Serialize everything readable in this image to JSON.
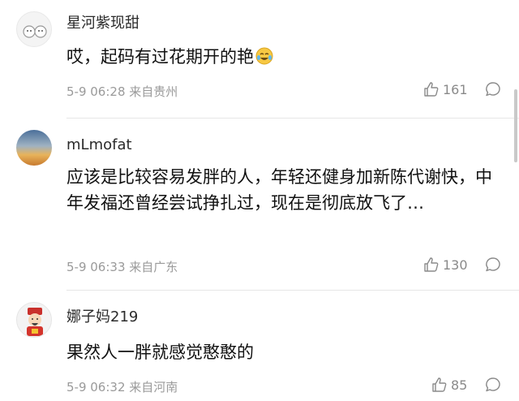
{
  "comments": [
    {
      "username": "星河紫现甜",
      "content": "哎，起码有过花期开的艳",
      "emoji": "laughing-tears-emoji",
      "time": "5-9 06:28",
      "location": "来自贵州",
      "likes": "161"
    },
    {
      "username": "mLmofat",
      "content": "应该是比较容易发胖的人，年轻还健身加新陈代谢快，中年发福还曾经尝试挣扎过，现在是彻底放飞了…",
      "time": "5-9 06:33",
      "location": "来自广东",
      "likes": "130"
    },
    {
      "username": "娜子妈219",
      "content": "果然人一胖就感觉憨憨的",
      "time": "5-9 06:32",
      "location": "来自河南",
      "likes": "85"
    }
  ],
  "colors": {
    "username": "#2b2b2b",
    "meta": "#9a9a9a",
    "divider": "#e6e6e6"
  }
}
